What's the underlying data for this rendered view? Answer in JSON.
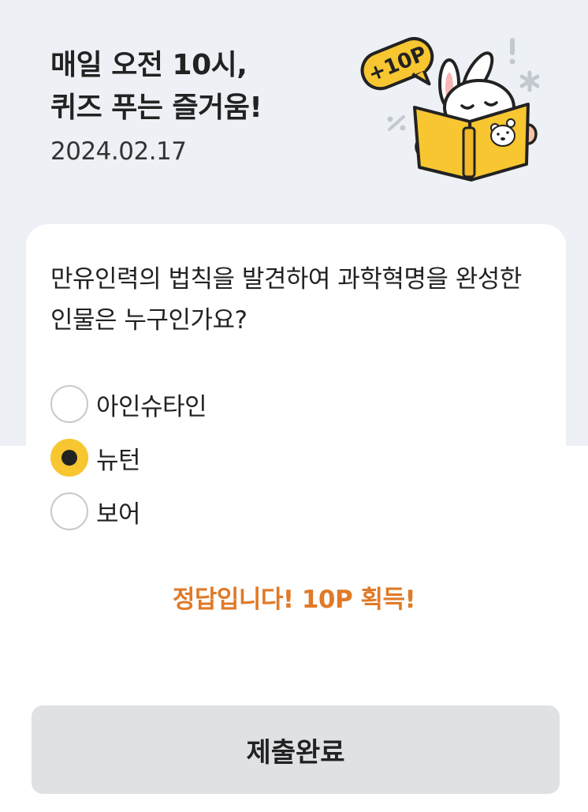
{
  "header": {
    "title_line1": "매일 오전 10시,",
    "title_line2": "퀴즈 푸는 즐거움!",
    "date": "2024.02.17",
    "badge_text": "+10P"
  },
  "quiz": {
    "question": "만유인력의 법칙을 발견하여 과학혁명을 완성한 인물은 누구인가요?",
    "options": [
      {
        "label": "아인슈타인",
        "selected": false
      },
      {
        "label": "뉴턴",
        "selected": true
      },
      {
        "label": "보어",
        "selected": false
      }
    ],
    "result_text": "정답입니다! 10P 획득!"
  },
  "submit": {
    "label": "제출완료"
  },
  "colors": {
    "accent": "#f7c630",
    "result": "#e07a28",
    "background_top": "#edf0f5",
    "button_bg": "#dfe1e4"
  },
  "icons": {
    "illustration": "rabbit-reading-book-illustration",
    "radio_selected": "radio-selected-icon",
    "radio_unselected": "radio-unselected-icon"
  }
}
